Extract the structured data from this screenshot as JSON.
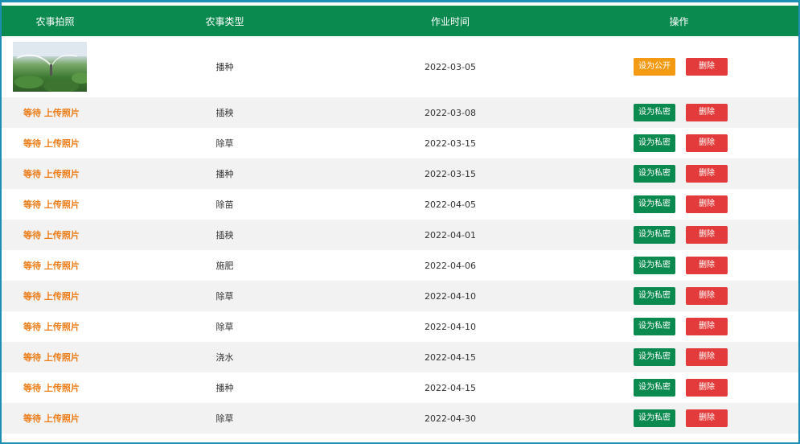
{
  "table": {
    "headers": {
      "photo": "农事拍照",
      "type": "农事类型",
      "time": "作业时间",
      "ops": "操作"
    },
    "pending_photo_label": "等待 上传照片",
    "rows": [
      {
        "type": "播种",
        "date": "2022-03-05",
        "visibility_btn": "设为公开",
        "delete_btn": "删除"
      },
      {
        "type": "插秧",
        "date": "2022-03-08",
        "visibility_btn": "设为私密",
        "delete_btn": "删除"
      },
      {
        "type": "除草",
        "date": "2022-03-15",
        "visibility_btn": "设为私密",
        "delete_btn": "删除"
      },
      {
        "type": "播种",
        "date": "2022-03-15",
        "visibility_btn": "设为私密",
        "delete_btn": "删除"
      },
      {
        "type": "除苗",
        "date": "2022-04-05",
        "visibility_btn": "设为私密",
        "delete_btn": "删除"
      },
      {
        "type": "插秧",
        "date": "2022-04-01",
        "visibility_btn": "设为私密",
        "delete_btn": "删除"
      },
      {
        "type": "施肥",
        "date": "2022-04-06",
        "visibility_btn": "设为私密",
        "delete_btn": "删除"
      },
      {
        "type": "除草",
        "date": "2022-04-10",
        "visibility_btn": "设为私密",
        "delete_btn": "删除"
      },
      {
        "type": "除草",
        "date": "2022-04-10",
        "visibility_btn": "设为私密",
        "delete_btn": "删除"
      },
      {
        "type": "浇水",
        "date": "2022-04-15",
        "visibility_btn": "设为私密",
        "delete_btn": "删除"
      },
      {
        "type": "播种",
        "date": "2022-04-15",
        "visibility_btn": "设为私密",
        "delete_btn": "删除"
      },
      {
        "type": "除草",
        "date": "2022-04-30",
        "visibility_btn": "设为私密",
        "delete_btn": "删除"
      }
    ]
  },
  "colors": {
    "header": "#0a8a4f",
    "private_button": "#0a8a4f",
    "public_button": "#f39a12",
    "delete_button": "#e33b3b",
    "pending_text": "#ee7c16"
  }
}
